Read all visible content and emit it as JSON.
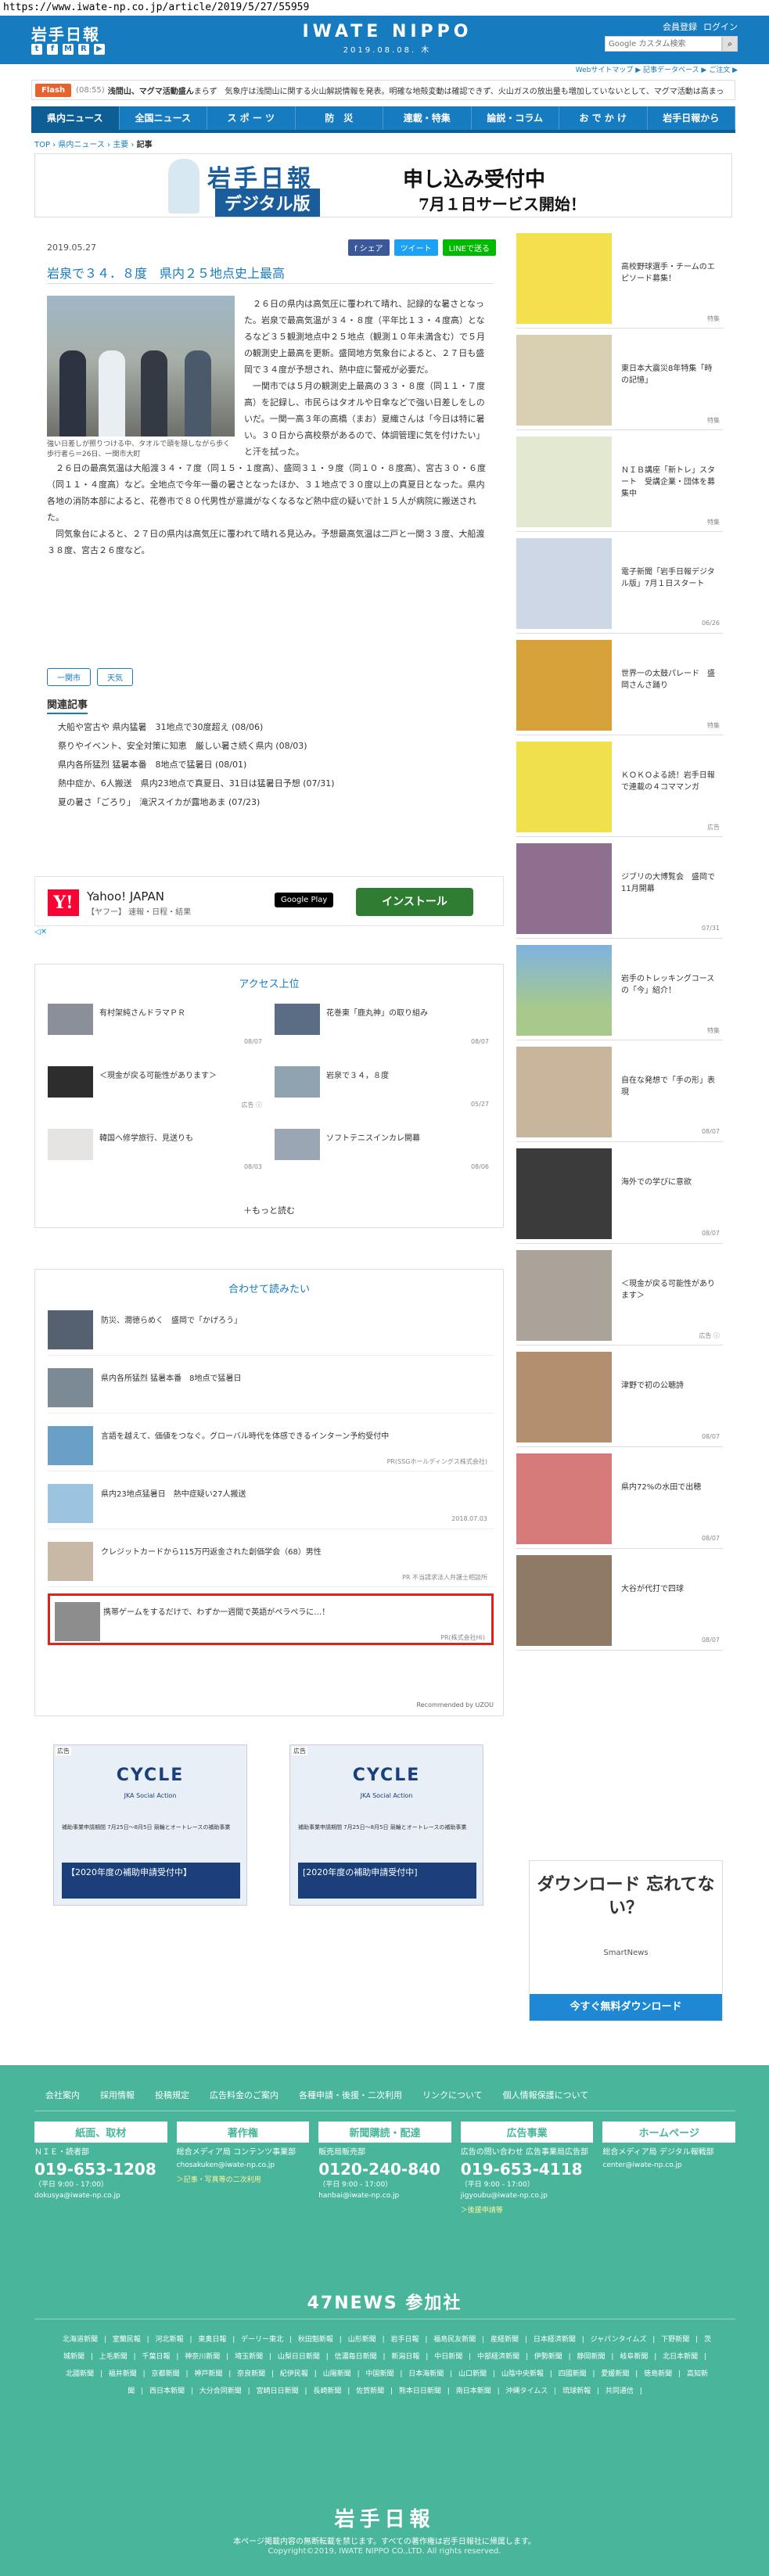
{
  "url": "https://www.iwate-np.co.jp/article/2019/5/27/55959",
  "header": {
    "logo": "岩手日報",
    "brand": "IWATE NIPPO",
    "date": "2019.08.08. 木",
    "links": [
      "会員登録",
      "ログイン"
    ],
    "search_placeholder": "Google カスタム検索",
    "search_button": "検索",
    "sub_links": "Webサイトマップ ▶ 記事データベース ▶ ご注文 ▶",
    "social": [
      "t",
      "f",
      "M",
      "R",
      "▶"
    ]
  },
  "flash": {
    "label": "Flash",
    "time": "(08:55)",
    "bold": "浅間山、マグマ活動盛ん",
    "text": "まらず　気象庁は浅間山に関する火山解説情報を発表。明確な地殻変動は確認できず、火山ガスの放出量も増加していないとして、マグマ活動は高まっ"
  },
  "nav": [
    "県内ニュース",
    "全国ニュース",
    "ス ポ ー ツ",
    "防　災",
    "連載・特集",
    "論説・コラム",
    "お で か け",
    "岩手日報から"
  ],
  "breadcrumb": [
    "TOP",
    "県内ニュース",
    "主要",
    "記事"
  ],
  "banner": {
    "logo": "岩手日報",
    "digital": "デジタル版",
    "title": "申し込み受付中",
    "sub": "7月１日サービス開始！"
  },
  "article": {
    "date": "2019.05.27",
    "share": [
      "f シェア",
      "ツイート",
      "LINEで送る"
    ],
    "title": "岩泉で３４．８度　県内２５地点史上最高",
    "caption": "強い日差しが照りつける中、タオルで頭を隠しながら歩く歩行者ら＝26日、一関市大町",
    "p1": "２６日の県内は高気圧に覆われて晴れ、記録的な暑さとなった。岩泉で最高気温が３４・８度（平年比１３・４度高）となるなど３５観測地点中２５地点（観測１０年未満含む）で５月の観測史上最高を更新。盛岡地方気象台によると、２７日も盛岡で３４度が予想され、熱中症に警戒が必要だ。",
    "p2": "一関市では５月の観測史上最高の３３・８度（同１１・７度高）を記録し、市民らはタオルや日傘などで強い日差しをしのいだ。一関一高３年の高橋（まお）夏織さんは「今日は特に暑い。３０日から高校祭があるので、体調管理に気を付けたい」と汗を拭った。",
    "p3": "２６日の最高気温は大船渡３４・７度（同１５・１度高）、盛岡３１・９度（同１０・８度高）、宮古３０・６度（同１１・４度高）など。全地点で今年一番の暑さとなったほか、３１地点で３０度以上の真夏日となった。県内各地の消防本部によると、花巻市で８０代男性が意識がなくなるなど熱中症の疑いで計１５人が病院に搬送された。",
    "p4": "同気象台によると、２７日の県内は高気圧に覆われて晴れる見込み。予想最高気温は二戸と一関３３度、大船渡３８度、宮古２６度など。",
    "tags": [
      "一関市",
      "天気"
    ],
    "related_heading": "関連記事",
    "related": [
      "大船や宮古や 県内猛暑　31地点で30度超え (08/06)",
      "祭りやイベント、安全対策に知恵　厳しい暑さ続く県内 (08/03)",
      "県内各所猛烈 猛暑本番　8地点で猛暑日 (08/01)",
      "熱中症か、6人搬送　県内23地点で真夏日、31日は猛暑日予想 (07/31)",
      "夏の暑さ「ごろり」　滝沢スイカが露地あま (07/23)"
    ]
  },
  "yahoo": {
    "logo": "Y!",
    "name": "Yahoo! JAPAN",
    "sub": "【ヤフー】 速報・日程・結果",
    "gp": "Google Play",
    "install": "インストール",
    "adx": "◁✕"
  },
  "access": {
    "heading": "アクセス上位",
    "items": [
      {
        "title": "有村架純さんドラマＰＲ",
        "date": "08/07"
      },
      {
        "title": "花巻東「鹿丸神」の取り組み",
        "date": "08/07"
      },
      {
        "title": "＜現金が戻る可能性があります＞",
        "date": "広告 ⓘ"
      },
      {
        "title": "岩泉で３４，８度",
        "date": "05/27"
      },
      {
        "title": "韓国へ修学旅行、見送りも",
        "date": "08/03"
      },
      {
        "title": "ソフトテニスインカレ開幕",
        "date": "08/06"
      }
    ],
    "more": "＋もっと読む"
  },
  "reco": {
    "heading": "合わせて読みたい",
    "items": [
      {
        "title": "防災、潤徳らめく　盛岡で「かげろう」",
        "src": ""
      },
      {
        "title": "県内各所猛烈 猛暑本番　8地点で猛暑日",
        "src": ""
      },
      {
        "title": "言語を越えて、価値をつなぐ。グローバル時代を体感できるインターン予約受付中",
        "src": "PR(SSGホールディングス株式会社)"
      },
      {
        "title": "県内23地点猛暑日　熱中症疑い27人搬送",
        "src": "2018.07.03"
      },
      {
        "title": "クレジットカードから115万円返金された創価学会（68）男性",
        "src": "PR 不当請求法人弁護士相談所"
      },
      {
        "title": "携帯ゲームをするだけで、わずか一週間で英語がペラペラに…！",
        "src": "PR(株式会社Hi)"
      }
    ],
    "foot": "Recommended by ᑌZOU"
  },
  "bottom_ads": [
    {
      "tag": "広告",
      "cyc": "CYCLE",
      "cyc2": "JKA Social Action",
      "info": "補助事業申請期間 7月25日〜8月5日 競輪とオートレースの補助事業",
      "cta": "【2020年度の補助申請受付中】"
    },
    {
      "tag": "広告",
      "cyc": "CYCLE",
      "cyc2": "JKA Social Action",
      "info": "補助事業申請期間 7月25日〜8月5日 競輪とオートレースの補助事業",
      "cta": "[2020年度の補助申請受付中]"
    }
  ],
  "sidebar": [
    {
      "title": "高校野球選手・チームのエピソード募集！",
      "date": "特集"
    },
    {
      "title": "東日本大震災8年特集「時の記憶」",
      "date": "特集"
    },
    {
      "title": "ＮＩＢ講座「新トレ」スタート　受講企業・団体を募集中",
      "date": "特集"
    },
    {
      "title": "電子新聞「岩手日報デジタル版」7月１日スタート",
      "date": "06/26"
    },
    {
      "title": "世界一の太鼓パレード　盛岡さんさ踊り",
      "date": "特集"
    },
    {
      "title": "ＫＯＫＯよる読！岩手日報で連載の４コママンガ",
      "date": "広告"
    },
    {
      "title": "ジブリの大博覧会　盛岡で11月開幕",
      "date": "07/31"
    },
    {
      "title": "岩手のトレッキングコースの「今」紹介！",
      "date": "特集"
    },
    {
      "title": "自在な発想で「手の形」表現",
      "date": "08/07"
    },
    {
      "title": "海外での学びに意欲",
      "date": "08/07"
    },
    {
      "title": "＜現金が戻る可能性があります＞",
      "date": "広告 ⓘ"
    },
    {
      "title": "津野で初の公聴詩",
      "date": "08/07"
    },
    {
      "title": "県内72%の水田で出穂",
      "date": "08/07"
    },
    {
      "title": "大谷が代打で四球",
      "date": "08/07"
    }
  ],
  "download_ad": {
    "big": "ダウンロード 忘れてない？",
    "sn": "SmartNews",
    "btn": "今すぐ無料ダウンロード"
  },
  "footer": {
    "links": [
      "会社案内",
      "採用情報",
      "投稿規定",
      "広告料金のご案内",
      "各種申請・後援・二次利用",
      "リンクについて",
      "個人情報保護について"
    ],
    "cols": [
      {
        "h": "紙面、取材",
        "l": "ＮＩＥ・読者部",
        "num": "019-653-1208",
        "time": "（平日 9:00 - 17:00）",
        "mail": "dokusya@iwate-np.co.jp",
        "note": ""
      },
      {
        "h": "著作権",
        "l": "総合メディア局 コンテンツ事業部",
        "num": "",
        "time": "",
        "mail": "chosakuken@iwate-np.co.jp",
        "note": "＞記事・写真等の二次利用"
      },
      {
        "h": "新聞購読・配達",
        "l": "販売局販売部",
        "num": "0120-240-840",
        "time": "（平日 9:00 - 17:00）",
        "mail": "hanbai@iwate-np.co.jp",
        "note": ""
      },
      {
        "h": "広告事業",
        "l": "広告の問い合わせ 広告事業局広告部",
        "num": "019-653-4118",
        "time": "（平日 9:00 - 17:00）",
        "mail": "jigyoubu@iwate-np.co.jp",
        "note": "＞後援申請等"
      },
      {
        "h": "ホームページ",
        "l": "総合メディア局 デジタル報戦部",
        "num": "",
        "time": "",
        "mail": "center@iwate-np.co.jp",
        "note": ""
      }
    ],
    "n47": "47NEWS 参加社",
    "n47list": [
      "北海道新聞",
      "室蘭民報",
      "河北新報",
      "東奥日報",
      "デーリー東北",
      "秋田魁新報",
      "山形新聞",
      "岩手日報",
      "福島民友新聞",
      "産経新聞",
      "日本経済新聞",
      "ジャパンタイムズ",
      "下野新聞",
      "茨城新聞",
      "上毛新聞",
      "千葉日報",
      "神奈川新聞",
      "埼玉新聞",
      "山梨日日新聞",
      "信濃毎日新聞",
      "新潟日報",
      "中日新聞",
      "中部経済新聞",
      "伊勢新聞",
      "静岡新聞",
      "岐阜新聞",
      "北日本新聞",
      "北國新聞",
      "福井新聞",
      "京都新聞",
      "神戸新聞",
      "奈良新聞",
      "紀伊民報",
      "山陽新聞",
      "中国新聞",
      "日本海新聞",
      "山口新聞",
      "山陰中央新報",
      "四國新聞",
      "愛媛新聞",
      "徳島新聞",
      "高知新聞",
      "西日本新聞",
      "大分合同新聞",
      "宮崎日日新聞",
      "長崎新聞",
      "佐賀新聞",
      "熊本日日新聞",
      "南日本新聞",
      "沖縄タイムス",
      "琉球新報",
      "共同通信"
    ],
    "logo": "岩手日報",
    "copy1": "本ページ掲載内容の無断転載を禁じます。すべての著作権は岩手日報社に帰属します。",
    "copy2": "Copyright©2019, IWATE NIPPO CO.,LTD. All rights reserved."
  }
}
